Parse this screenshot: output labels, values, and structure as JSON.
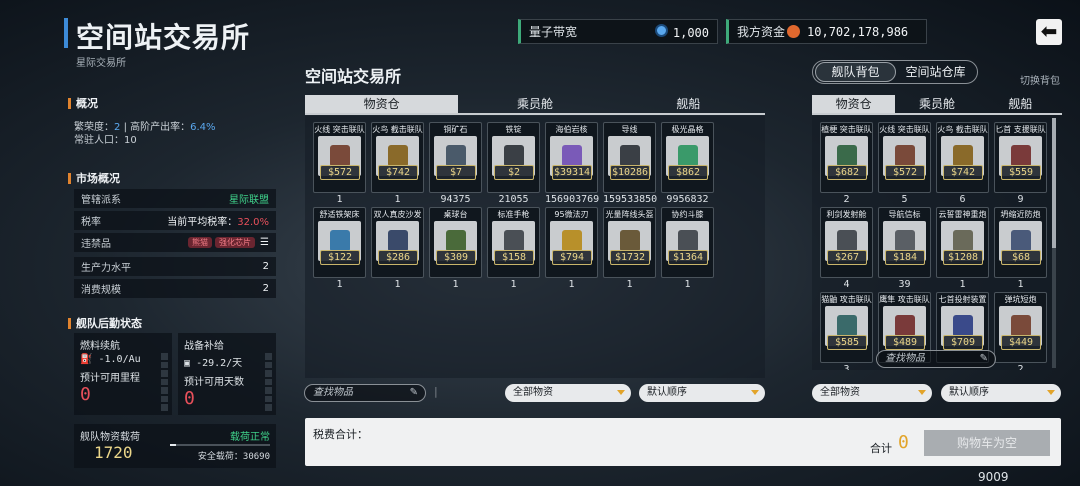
{
  "header": {
    "title": "空间站交易所",
    "subtitle": "星际交易所",
    "resources": [
      {
        "label": "量子带宽",
        "value": "1,000",
        "icon": "quantum-icon",
        "color": "#5aa8ee"
      },
      {
        "label": "我方资金",
        "value": "10,702,178,986",
        "icon": "funds-icon",
        "color": "#e0682e"
      }
    ],
    "back_icon": "back-arrow-icon"
  },
  "overview": {
    "heading": "概况",
    "prosperity_label": "繁荣度：",
    "prosperity_value": "2",
    "output_label": "| 高阶产出率：",
    "output_value": "6.4%",
    "population_label": "常驻人口：",
    "population_value": "10"
  },
  "market": {
    "heading": "市场概况",
    "rows": [
      {
        "label": "管辖派系",
        "value": "星际联盟"
      },
      {
        "label": "税率",
        "value_prefix": "当前平均税率：",
        "value": "32.0%"
      },
      {
        "label": "违禁品",
        "tags": [
          "熊猫",
          "强化芯片"
        ],
        "more": "☰"
      },
      {
        "label": "生产力水平",
        "value": "2"
      },
      {
        "label": "消费规模",
        "value": "2"
      }
    ]
  },
  "logistics": {
    "heading": "舰队后勤状态",
    "fuel": {
      "label": "燃料续航",
      "rate": "-1.0/Au",
      "sub": "预计可用里程",
      "value": "0"
    },
    "supply": {
      "label": "战备补给",
      "rate": "-29.2/天",
      "sub": "预计可用天数",
      "value": "0"
    },
    "cargo": {
      "label": "舰队物资载荷",
      "status": "载荷正常",
      "value": "1720",
      "safe_label": "安全载荷：",
      "safe_value": "30690",
      "fill": 0.06
    }
  },
  "exchange": {
    "title": "空间站交易所",
    "tabs": [
      "物资仓",
      "乘员舱",
      "舰船"
    ],
    "active_tab": 0,
    "items": [
      {
        "name": "火线 突击联队",
        "price": "$572",
        "qty": "1",
        "color": "#7a4a3a"
      },
      {
        "name": "火鸟 截击联队",
        "price": "$742",
        "qty": "1",
        "color": "#8a6a2a"
      },
      {
        "name": "铜矿石",
        "price": "$7",
        "qty": "94375",
        "color": "#4a5a6a"
      },
      {
        "name": "铁锭",
        "price": "$2",
        "qty": "21055",
        "color": "#3a3f45"
      },
      {
        "name": "海伯岩核",
        "price": "$39314",
        "qty": "156903769",
        "color": "#7a5ab8"
      },
      {
        "name": "导线",
        "price": "$10286",
        "qty": "159533850",
        "color": "#3a3f45"
      },
      {
        "name": "极光晶格",
        "price": "$862",
        "qty": "9956832",
        "color": "#3a9a6a"
      },
      {
        "name": "舒适铁架床",
        "price": "$122",
        "qty": "1",
        "color": "#3a7aaa"
      },
      {
        "name": "双人真皮沙发",
        "price": "$286",
        "qty": "1",
        "color": "#3a4a6a"
      },
      {
        "name": "桌球台",
        "price": "$309",
        "qty": "1",
        "color": "#4a6a3a"
      },
      {
        "name": "标准手枪",
        "price": "$158",
        "qty": "1",
        "color": "#4a4f55"
      },
      {
        "name": "95微法刃",
        "price": "$794",
        "qty": "1",
        "color": "#b8902a"
      },
      {
        "name": "光量阵线头盔",
        "price": "$1732",
        "qty": "1",
        "color": "#6a5a3a"
      },
      {
        "name": "协约斗膝",
        "price": "$1364",
        "qty": "1",
        "color": "#4a4f55"
      }
    ],
    "search_placeholder": "查找物品",
    "filter": "全部物资",
    "sort": "默认顺序"
  },
  "tax": {
    "label": "税费合计：",
    "total_label": "合计",
    "total_value": "0",
    "buy_label": "购物车为空",
    "footer_number": "9009"
  },
  "inventory": {
    "switch": [
      "舰队背包",
      "空间站仓库"
    ],
    "switch_active": 0,
    "switch_hint": "切换背包",
    "tabs": [
      "物资仓",
      "乘员舱",
      "舰船"
    ],
    "active_tab": 0,
    "items": [
      {
        "name": "植梗 突击联队",
        "price": "$682",
        "qty": "2",
        "color": "#3a6a4a"
      },
      {
        "name": "火线 突击联队",
        "price": "$572",
        "qty": "5",
        "color": "#7a4a3a"
      },
      {
        "name": "火鸟 截击联队",
        "price": "$742",
        "qty": "6",
        "color": "#8a6a2a"
      },
      {
        "name": "匕首 支援联队",
        "price": "$559",
        "qty": "9",
        "color": "#7a3a3a"
      },
      {
        "name": "利剑发射舱",
        "price": "$267",
        "qty": "4",
        "color": "#4a4f55"
      },
      {
        "name": "导航信标",
        "price": "$184",
        "qty": "39",
        "color": "#5a5f65"
      },
      {
        "name": "云誓雷神重炮",
        "price": "$1208",
        "qty": "1",
        "color": "#6a6a5a"
      },
      {
        "name": "坍缩近防炮",
        "price": "$68",
        "qty": "1",
        "color": "#4a5a7a"
      },
      {
        "name": "猫鼬 攻击联队",
        "price": "$585",
        "qty": "3",
        "color": "#3a6a6a"
      },
      {
        "name": "鹰隼 攻击联队",
        "price": "$489",
        "qty": "",
        "color": "#7a3a3a"
      },
      {
        "name": "七首投射装置",
        "price": "$709",
        "qty": "",
        "color": "#3a4a8a"
      },
      {
        "name": "弹坑短炮",
        "price": "$449",
        "qty": "2",
        "color": "#7a4a3a"
      }
    ],
    "search_placeholder": "查找物品",
    "filter": "全部物资",
    "sort": "默认顺序"
  }
}
